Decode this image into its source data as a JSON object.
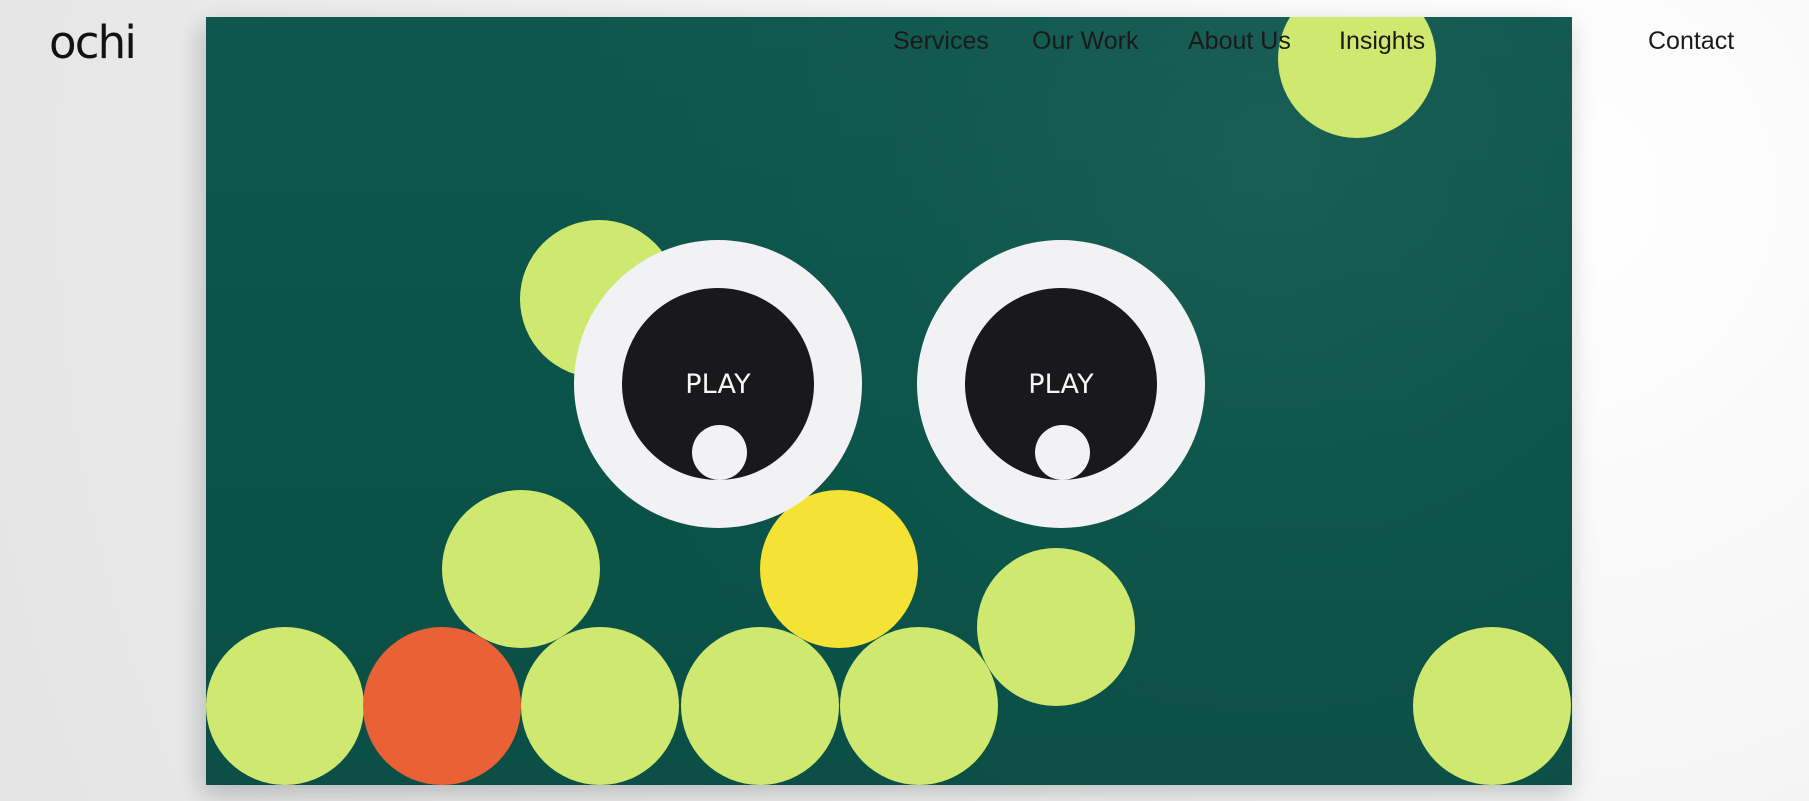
{
  "brand": {
    "logo": "ochi"
  },
  "nav": {
    "items": [
      {
        "label": "Services"
      },
      {
        "label": "Our Work"
      },
      {
        "label": "About Us"
      },
      {
        "label": "Insights"
      }
    ],
    "contact_label": "Contact"
  },
  "hero": {
    "eyes": [
      {
        "label": "PLAY"
      },
      {
        "label": "PLAY"
      }
    ],
    "colors": {
      "background": "#0b5248",
      "lime": "#cfe970",
      "orange": "#ea6136",
      "yellow": "#f4e234",
      "eye_white": "#f2f2f4",
      "pupil": "#19191c"
    }
  }
}
